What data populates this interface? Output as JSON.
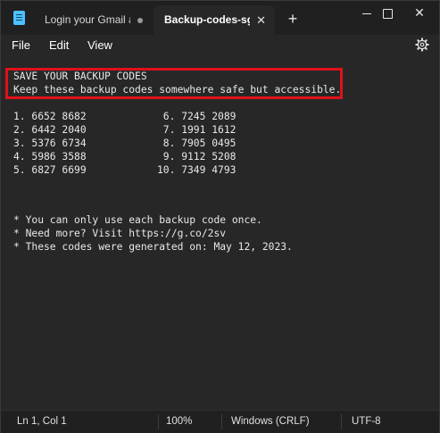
{
  "tabs": [
    {
      "label": "Login your Gmail acc",
      "active": false,
      "modified": true
    },
    {
      "label": "Backup-codes-sgno",
      "active": true
    }
  ],
  "menu": [
    "File",
    "Edit",
    "View"
  ],
  "document": {
    "heading": "SAVE YOUR BACKUP CODES",
    "subheading": "Keep these backup codes somewhere safe but accessible.",
    "codes_left": [
      "1. 6652 8682",
      "2. 6442 2040",
      "3. 5376 6734",
      "4. 5986 3588",
      "5. 6827 6699"
    ],
    "codes_right": [
      " 6. 7245 2089",
      " 7. 1991 1612",
      " 8. 7905 0495",
      " 9. 9112 5208",
      "10. 7349 4793"
    ],
    "notes": [
      "* You can only use each backup code once.",
      "* Need more? Visit https://g.co/2sv",
      "* These codes were generated on: May 12, 2023."
    ]
  },
  "status": {
    "position": "Ln 1, Col 1",
    "zoom": "100%",
    "line_ending": "Windows (CRLF)",
    "encoding": "UTF-8"
  },
  "colors": {
    "highlight_border": "#e0101a",
    "background": "#272727"
  }
}
